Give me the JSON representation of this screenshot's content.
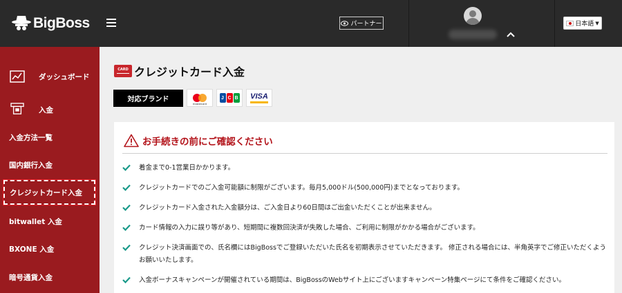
{
  "header": {
    "logo_text": "BigBoss",
    "partner_label": "パートナー",
    "language_label": "日本語",
    "user_chevron": "⌃"
  },
  "sidebar": {
    "items": [
      {
        "label": "ダッシュボード",
        "icon": "dashboard-chart-icon"
      },
      {
        "label": "入金",
        "icon": "deposit-card-icon"
      },
      {
        "label": "入金方法一覧"
      },
      {
        "label": "国内銀行入金"
      },
      {
        "label": "クレジットカード入金",
        "active": true
      },
      {
        "label": "bitwallet 入金"
      },
      {
        "label": "BXONE 入金"
      },
      {
        "label": "暗号通貨入金"
      }
    ]
  },
  "main": {
    "card_icon_text": "CARD",
    "page_title": "クレジットカード入金",
    "brands_label": "対応ブランド",
    "brands": {
      "mastercard_text": "mastercard",
      "jcb_letters": [
        "J",
        "C",
        "B"
      ],
      "visa_text": "VISA"
    },
    "notice": {
      "title": "お手続きの前にご確認ください",
      "items": [
        "着金まで0-1営業日かかります。",
        "クレジットカードでのご入金可能額に制限がございます。毎月5,000ドル(500,000円)までとなっております。",
        "クレジットカード入金された入金額分は、ご入金日より60日間はご出金いただくことが出来ません。",
        "カード情報の入力に誤り等があり、短期間に複数回決済が失敗した場合、ご利用に制限がかかる場合がございます。",
        "クレジット決済画面での、氏名欄にはBigBossでご登録いただいた氏名を初期表示させていただきます。 修正される場合には、半角英字でご修正いただくようお願いいたします。",
        "入金ボーナスキャンペーンが開催されている期間は、BigBossのWebサイト上にございますキャンペーン特集ページにて条件をご確認ください。"
      ]
    }
  },
  "colors": {
    "topbar": "#2a2a2a",
    "sidebar": "#9a1b1f",
    "accent_red": "#b3141b",
    "check_teal": "#1a9a8a"
  }
}
